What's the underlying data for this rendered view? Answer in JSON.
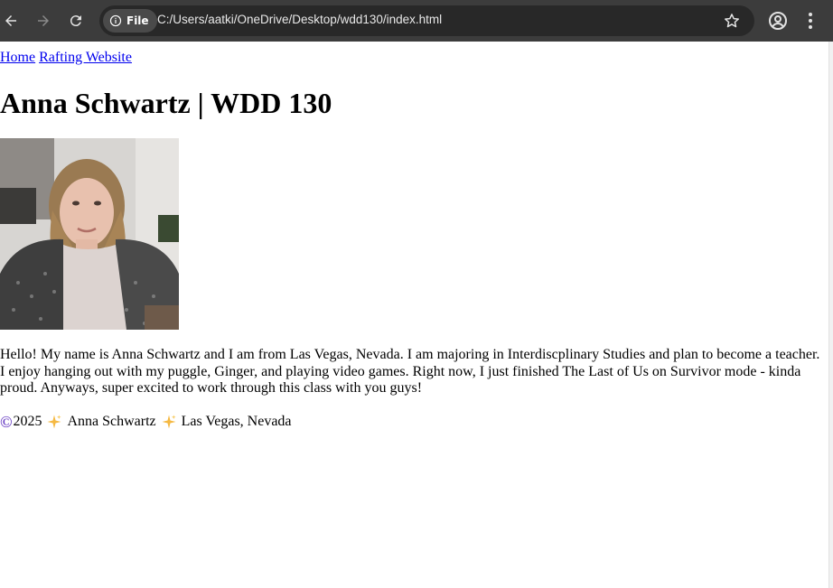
{
  "browser": {
    "address_chip_label": "File",
    "url": "C:/Users/aatki/OneDrive/Desktop/wdd130/index.html",
    "icons": [
      "back-arrow-icon",
      "forward-arrow-icon",
      "reload-icon",
      "info-icon",
      "star-icon",
      "profile-icon",
      "kebab-menu-icon"
    ]
  },
  "page": {
    "nav": [
      {
        "label": "Home"
      },
      {
        "label": "Rafting Website"
      }
    ],
    "title": "Anna Schwartz | WDD 130",
    "intro": "Hello! My name is Anna Schwartz and I am from Las Vegas, Nevada. I am majoring in Interdiscplinary Studies and plan to become a teacher. I enjoy hanging out with my puggle, Ginger, and playing video games. Right now, I just finished The Last of Us on Survivor mode - kinda proud. Anyways, super excited to work through this class with you guys!",
    "footer": {
      "copyright_symbol": "©",
      "year": "2025",
      "name": "Anna Schwartz",
      "location": "Las Vegas, Nevada",
      "icons": [
        "copyright-icon",
        "sparkle-icon"
      ]
    }
  },
  "colors": {
    "chrome_bg": "#3c3c3c",
    "omnibox_bg": "#282828",
    "link": "#0000ee",
    "copyright": "#6a3fc4",
    "sparkle": "#f5b942"
  }
}
